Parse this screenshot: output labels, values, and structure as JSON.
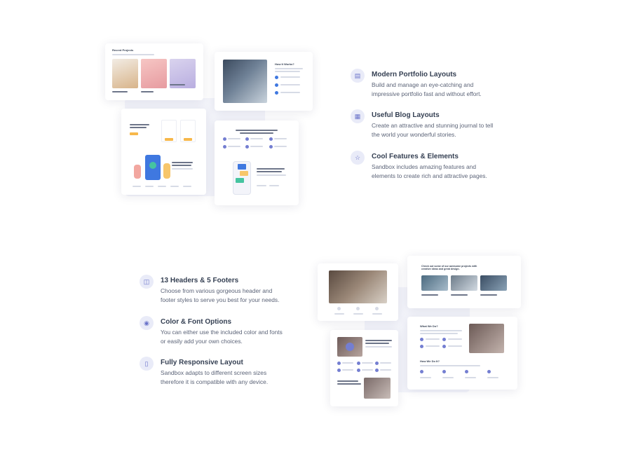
{
  "features_top": [
    {
      "title": "Modern Portfolio Layouts",
      "desc": "Build and manage an eye-catching and impressive portfolio fast and without effort.",
      "icon": "window-icon"
    },
    {
      "title": "Useful Blog Layouts",
      "desc": "Create an attractive and stunning journal to tell the world your wonderful stories.",
      "icon": "calendar-icon"
    },
    {
      "title": "Cool Features & Elements",
      "desc": "Sandbox includes amazing features and elements to create rich and attractive pages.",
      "icon": "star-icon"
    }
  ],
  "features_bottom": [
    {
      "title": "13 Headers & 5 Footers",
      "desc": "Choose from various gorgeous header and footer styles to serve you best for your needs.",
      "icon": "layout-icon"
    },
    {
      "title": "Color & Font Options",
      "desc": "You can either use the included color and fonts or easily add your own choices.",
      "icon": "palette-icon"
    },
    {
      "title": "Fully Responsive Layout",
      "desc": "Sandbox adapts to different screen sizes therefore it is compatible with any device.",
      "icon": "tablet-icon"
    }
  ],
  "previews": {
    "recent_projects": {
      "title": "Recent Projects"
    },
    "how_it_works": {
      "title": "How It Works?"
    },
    "what_we_do": {
      "title": "What We Do?"
    },
    "how_we_do_it": {
      "title": "How We Do It?"
    },
    "check_projects": {
      "title": "Check out some of our awesome projects with creative ideas and great design."
    }
  },
  "colors": {
    "accent": "#747ed1",
    "icon_bg": "#e9ebf8",
    "heading": "#343f52",
    "body_text": "#5c6478"
  }
}
